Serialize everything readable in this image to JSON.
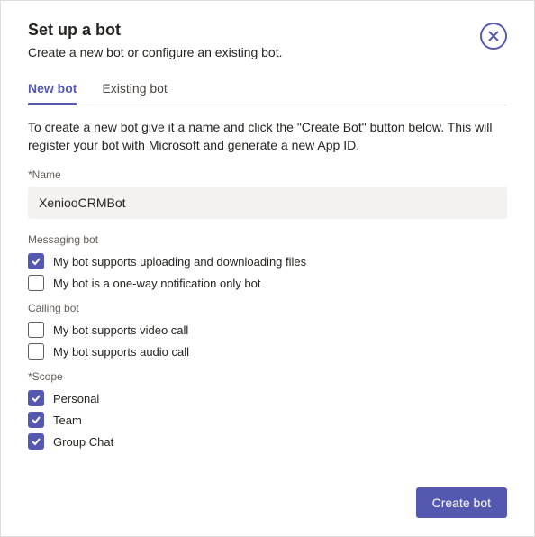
{
  "header": {
    "title": "Set up a bot",
    "subtitle": "Create a new bot or configure an existing bot."
  },
  "tabs": {
    "new": "New bot",
    "existing": "Existing bot"
  },
  "description": "To create a new bot give it a name and click the \"Create Bot\" button below. This will register your bot with Microsoft and generate a new App ID.",
  "name_field": {
    "label": "*Name",
    "value": "XeniooCRMBot"
  },
  "messaging": {
    "section_label": "Messaging bot",
    "upload_label": "My bot supports uploading and downloading files",
    "oneway_label": "My bot is a one-way notification only bot"
  },
  "calling": {
    "section_label": "Calling bot",
    "video_label": "My bot supports video call",
    "audio_label": "My bot supports audio call"
  },
  "scope": {
    "section_label": "*Scope",
    "personal_label": "Personal",
    "team_label": "Team",
    "group_label": "Group Chat"
  },
  "footer": {
    "create_label": "Create bot"
  }
}
